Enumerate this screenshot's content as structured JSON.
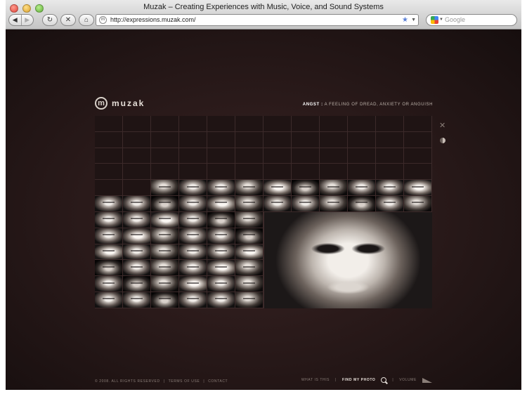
{
  "window": {
    "title": "Muzak – Creating Experiences with Music, Voice, and Sound Systems"
  },
  "toolbar": {
    "back_label": "◀",
    "forward_label": "▶",
    "reload_label": "↻",
    "stop_label": "✕",
    "home_label": "⌂",
    "url": "http://expressions.muzak.com/",
    "search_placeholder": "Google"
  },
  "site": {
    "logo_mark": "m",
    "logo_text": "muzak",
    "definition_term": "ANGST :",
    "definition_text": "A FEELING OF DREAD, ANXIETY OR ANGUISH"
  },
  "footer": {
    "copyright": "© 2008. ALL RIGHTS RESERVED",
    "terms": "TERMS OF USE",
    "contact": "CONTACT",
    "what_is_this": "WHAT IS THIS",
    "find_my_photo": "FIND MY PHOTO",
    "volume": "VOLUME",
    "separator": "|"
  },
  "grid": {
    "columns": 12,
    "rows": 12,
    "face_rows": [
      "000000000000",
      "000000000000",
      "000000000000",
      "000000000000",
      "001111111111",
      "111111111111",
      "111111",
      "111111",
      "111111",
      "111111",
      "111111",
      "111111"
    ],
    "feature_label": "featured portrait"
  },
  "colors": {
    "page_bg": "#2a1a1a",
    "grid_line": "#3c2a2a",
    "accent_text": "#ffffff"
  }
}
